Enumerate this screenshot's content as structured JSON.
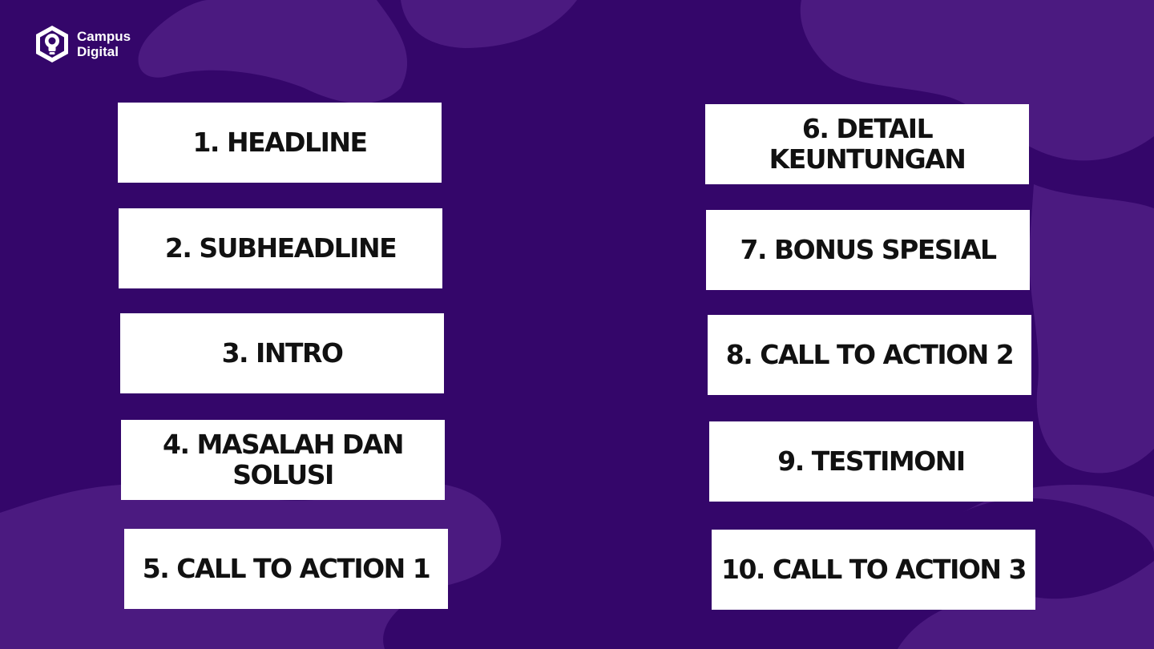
{
  "brand": {
    "line1": "Campus",
    "line2": "Digital",
    "logo_icon": "lightbulb-hexagon-icon"
  },
  "colors": {
    "background": "#34066a",
    "blob": "#4b1a80",
    "card": "#ffffff",
    "text": "#111111"
  },
  "items": [
    {
      "label": "1. HEADLINE"
    },
    {
      "label": "2. SUBHEADLINE"
    },
    {
      "label": "3. INTRO"
    },
    {
      "label": "4. MASALAH DAN SOLUSI"
    },
    {
      "label": "5. CALL TO ACTION 1"
    },
    {
      "label": "6. DETAIL KEUNTUNGAN"
    },
    {
      "label": "7. BONUS SPESIAL"
    },
    {
      "label": "8. CALL TO ACTION 2"
    },
    {
      "label": "9. TESTIMONI"
    },
    {
      "label": "10. CALL TO ACTION 3"
    }
  ]
}
